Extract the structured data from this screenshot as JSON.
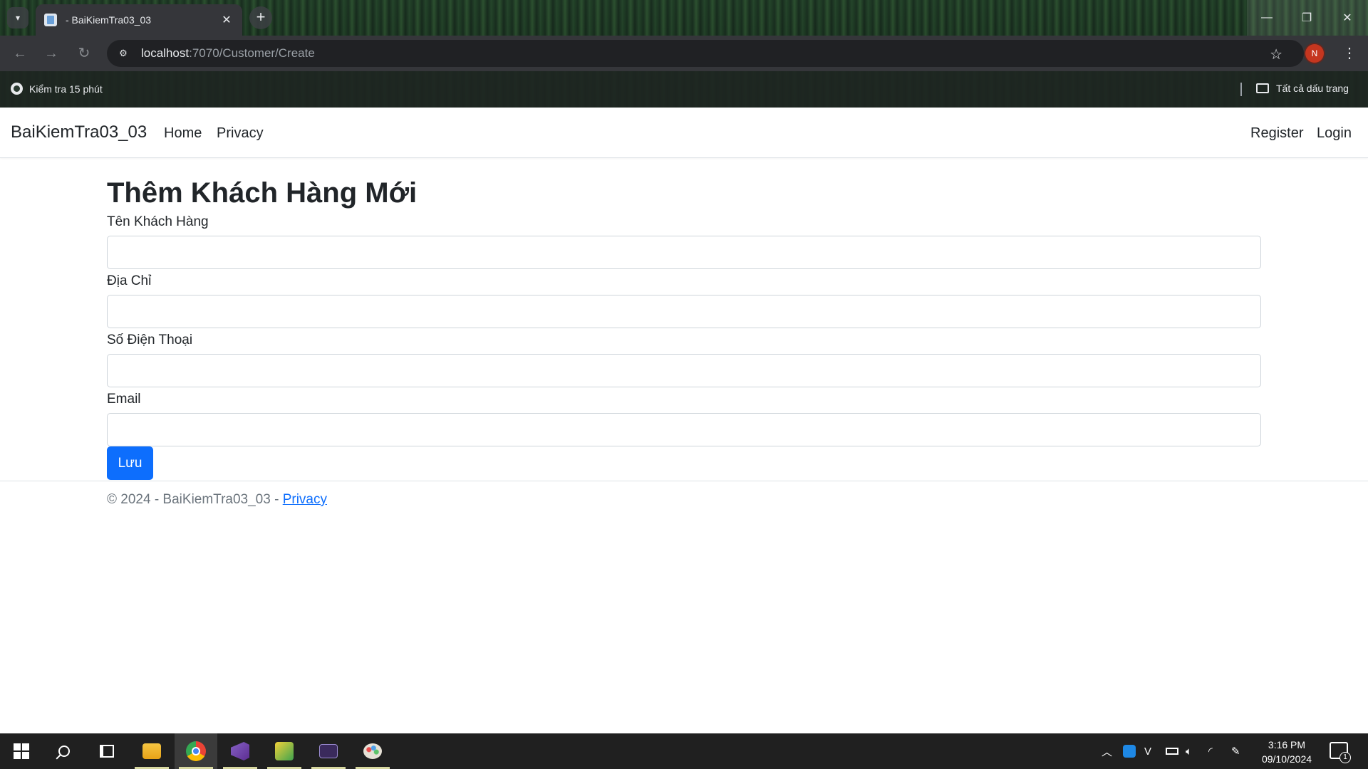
{
  "browser": {
    "tab_title": "- BaiKiemTra03_03",
    "tab_close_glyph": "✕",
    "new_tab_glyph": "+",
    "url_host": "localhost",
    "url_path": ":7070/Customer/Create",
    "profile_initial": "N",
    "bookmark_item": "Kiểm tra 15 phút",
    "bookmarks_folder": "Tất cả dấu trang",
    "window_controls": {
      "minimize": "—",
      "restore": "❐",
      "close": "✕"
    }
  },
  "navbar": {
    "brand": "BaiKiemTra03_03",
    "links": [
      "Home",
      "Privacy"
    ],
    "right_links": [
      "Register",
      "Login"
    ]
  },
  "form": {
    "title": "Thêm Khách Hàng Mới",
    "fields": [
      {
        "label": "Tên Khách Hàng",
        "value": ""
      },
      {
        "label": "Địa Chỉ",
        "value": ""
      },
      {
        "label": "Số Điện Thoại",
        "value": ""
      },
      {
        "label": "Email",
        "value": ""
      }
    ],
    "submit_label": "Lưu"
  },
  "footer": {
    "text": "© 2024 - BaiKiemTra03_03 - ",
    "link": "Privacy"
  },
  "taskbar": {
    "time": "3:16 PM",
    "date": "09/10/2024",
    "notification_count": "1",
    "apps": [
      "start-icon",
      "search-icon",
      "task-view-icon",
      "file-explorer-icon",
      "chrome-icon",
      "visual-studio-icon",
      "dev-tool-icon",
      "terminal-icon",
      "paint-icon"
    ]
  },
  "colors": {
    "primary": "#0d6efd",
    "brand_text": "#212529",
    "muted": "#6c757d"
  }
}
